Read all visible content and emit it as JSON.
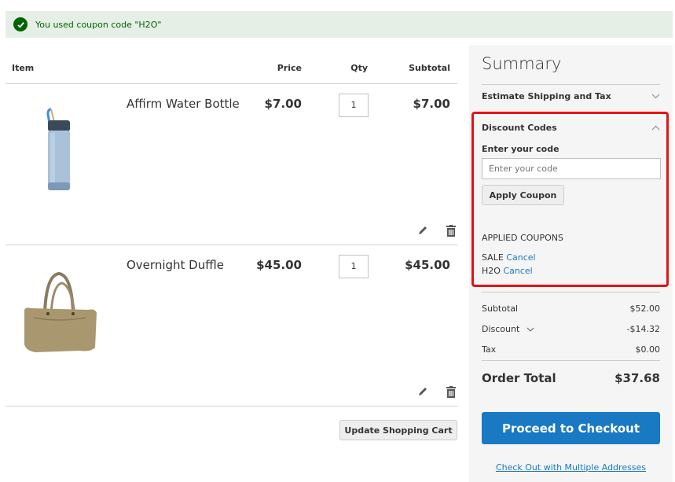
{
  "message": {
    "text": "You used coupon code \"H2O\"",
    "icon": "check-circle-icon",
    "color": "#006400"
  },
  "cart": {
    "headers": {
      "item": "Item",
      "price": "Price",
      "qty": "Qty",
      "subtotal": "Subtotal"
    },
    "items": [
      {
        "name": "Affirm Water Bottle",
        "price": "$7.00",
        "qty": "1",
        "subtotal": "$7.00",
        "image": "water-bottle-image"
      },
      {
        "name": "Overnight Duffle",
        "price": "$45.00",
        "qty": "1",
        "subtotal": "$45.00",
        "image": "duffle-bag-image"
      }
    ],
    "update_label": "Update Shopping Cart"
  },
  "summary": {
    "title": "Summary",
    "estimate_label": "Estimate Shipping and Tax",
    "discount": {
      "title": "Discount Codes",
      "label": "Enter your code",
      "placeholder": "Enter your code",
      "value": "",
      "apply_label": "Apply Coupon",
      "applied_title": "APPLIED COUPONS",
      "coupons": [
        {
          "code": "SALE",
          "cancel_label": "Cancel"
        },
        {
          "code": "H2O",
          "cancel_label": "Cancel"
        }
      ],
      "highlight_color": "#e31414"
    },
    "totals": {
      "subtotal_label": "Subtotal",
      "subtotal_value": "$52.00",
      "discount_label": "Discount",
      "discount_value": "-$14.32",
      "tax_label": "Tax",
      "tax_value": "$0.00",
      "order_total_label": "Order Total",
      "order_total_value": "$37.68"
    },
    "checkout_label": "Proceed to Checkout",
    "multi_address_label": "Check Out with Multiple Addresses",
    "accent_color": "#1979c3"
  }
}
